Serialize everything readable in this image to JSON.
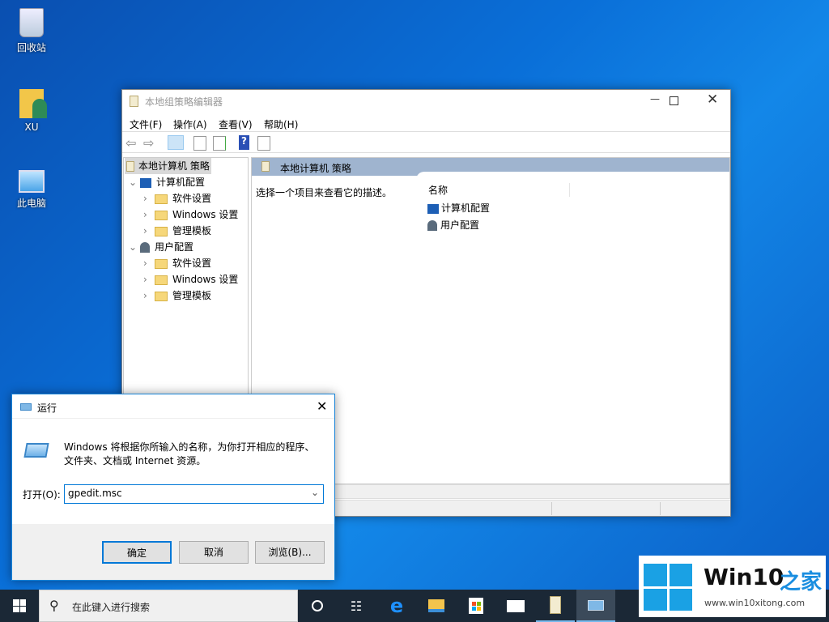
{
  "desktop": {
    "icons": [
      {
        "label": "回收站",
        "icon": "recycle-bin-icon"
      },
      {
        "label": "XU",
        "icon": "user-folder-icon"
      },
      {
        "label": "此电脑",
        "icon": "this-pc-icon"
      }
    ]
  },
  "gpedit": {
    "title": "本地组策略编辑器",
    "menu": [
      "文件(F)",
      "操作(A)",
      "查看(V)",
      "帮助(H)"
    ],
    "tree": {
      "root": "本地计算机 策略",
      "computer": "计算机配置",
      "user": "用户配置",
      "children": [
        "软件设置",
        "Windows 设置",
        "管理模板"
      ]
    },
    "header": "本地计算机 策略",
    "description": "选择一个项目来查看它的描述。",
    "column_name": "名称",
    "items": [
      "计算机配置",
      "用户配置"
    ]
  },
  "run": {
    "title": "运行",
    "description_line1": "Windows 将根据你所输入的名称，为你打开相应的程序、",
    "description_line2": "文件夹、文档或 Internet 资源。",
    "open_label": "打开(O):",
    "input_value": "gpedit.msc",
    "ok": "确定",
    "cancel": "取消",
    "browse": "浏览(B)..."
  },
  "taskbar": {
    "search_placeholder": "在此键入进行搜索",
    "apps": [
      "cortana-icon",
      "task-view-icon",
      "edge-icon",
      "file-explorer-icon",
      "store-icon",
      "mail-icon",
      "gpedit-icon",
      "run-icon"
    ]
  },
  "watermark": {
    "brand": "Win10",
    "brand_suffix": "之家",
    "url": "www.win10xitong.com"
  },
  "colors": {
    "accent": "#0078d7",
    "header": "#9fb4cf",
    "taskbar": "#1b2836"
  }
}
